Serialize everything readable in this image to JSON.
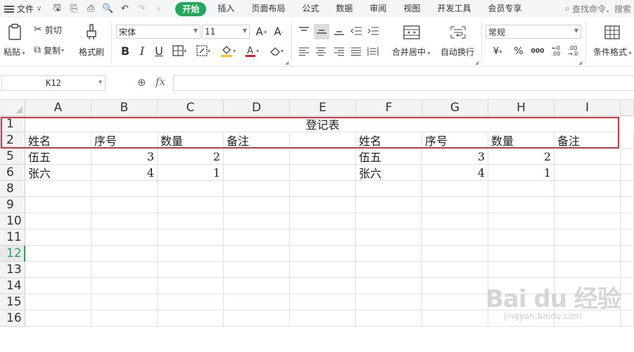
{
  "menubar": {
    "file_label": "文件",
    "tabs": [
      "开始",
      "插入",
      "页面布局",
      "公式",
      "数据",
      "审阅",
      "视图",
      "开发工具",
      "会员专享"
    ],
    "active_tab": "开始",
    "search_placeholder": "查找命令、搜索"
  },
  "ribbon": {
    "paste_label": "粘贴",
    "cut_label": "剪切",
    "copy_label": "复制",
    "format_painter_label": "格式刷",
    "font_name": "宋体",
    "font_size": "11",
    "merge_center_label": "合并居中",
    "auto_wrap_label": "自动换行",
    "number_format": "常规",
    "currency_symbol": "¥",
    "percent_symbol": "%",
    "thousands_symbol": "000",
    "conditional_format_label": "条件格式",
    "accent_color": "#1fa85a"
  },
  "formula_bar": {
    "name_box": "K12",
    "fx_label": "fx",
    "formula": ""
  },
  "sheet": {
    "columns": [
      "A",
      "B",
      "C",
      "D",
      "E",
      "F",
      "G",
      "H",
      "I"
    ],
    "rows": [
      "1",
      "2",
      "5",
      "6",
      "8",
      "9",
      "10",
      "11",
      "12",
      "13",
      "14",
      "15",
      "16"
    ],
    "selected_row": "12",
    "title": "登记表",
    "header_left": [
      "姓名",
      "序号",
      "数量",
      "备注"
    ],
    "header_right": [
      "姓名",
      "序号",
      "数量",
      "备注"
    ],
    "data_left": [
      [
        "伍五",
        "3",
        "2",
        ""
      ],
      [
        "张六",
        "4",
        "1",
        ""
      ]
    ],
    "data_right": [
      [
        "伍五",
        "3",
        "2",
        ""
      ],
      [
        "张六",
        "4",
        "1",
        ""
      ]
    ],
    "highlight_color": "#d6353b"
  },
  "watermark": {
    "logo": "Bai du 经验",
    "url": "jingyan.baidu.com"
  }
}
